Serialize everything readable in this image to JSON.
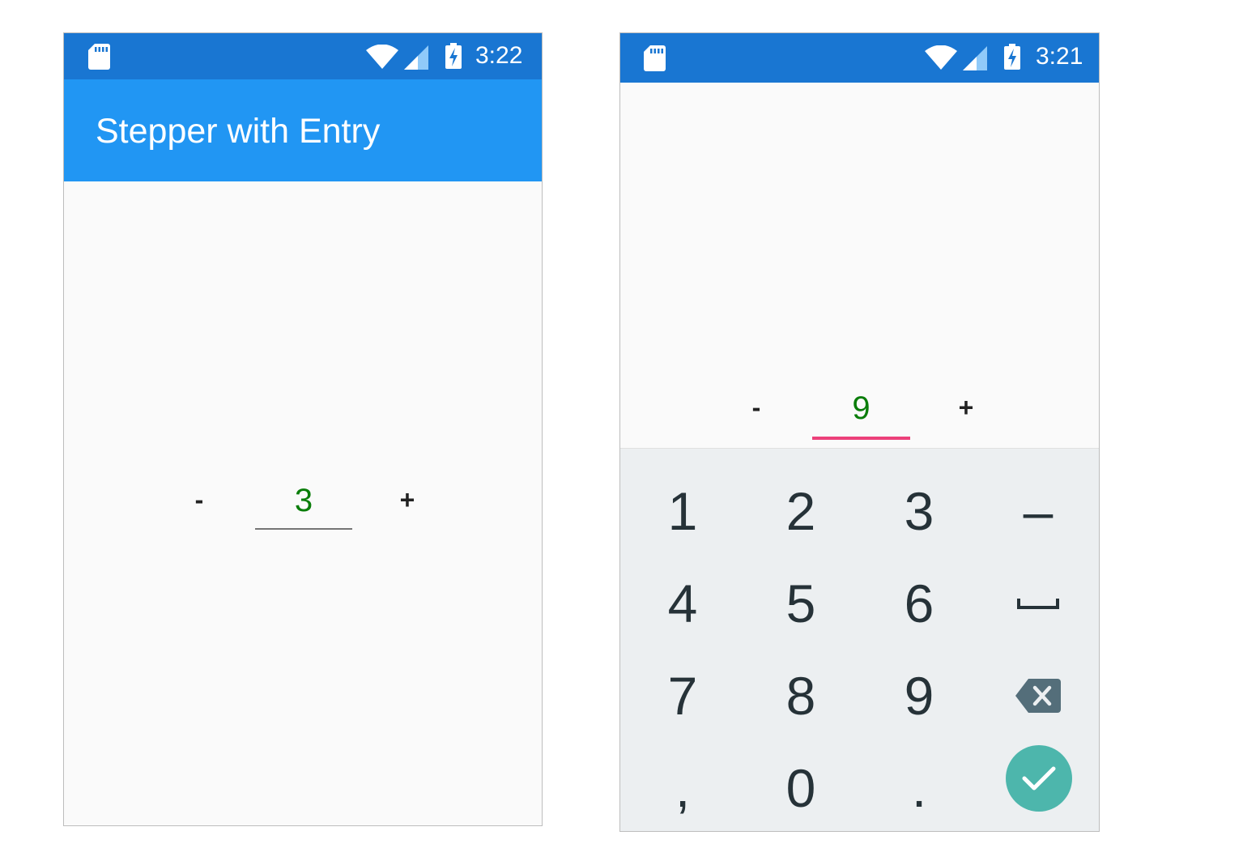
{
  "left_screen": {
    "status_bar": {
      "time": "3:22"
    },
    "app_bar": {
      "title": "Stepper with Entry"
    },
    "stepper": {
      "minus_label": "-",
      "value": "3",
      "plus_label": "+"
    }
  },
  "right_screen": {
    "status_bar": {
      "time": "3:21"
    },
    "stepper": {
      "minus_label": "-",
      "value": "9",
      "plus_label": "+"
    },
    "keyboard": {
      "keys": [
        "1",
        "2",
        "3",
        "–",
        "4",
        "5",
        "6",
        "␣",
        "7",
        "8",
        "9",
        "⌫",
        ",",
        "0",
        "."
      ],
      "done_icon": "check-icon"
    }
  },
  "colors": {
    "status_bar": "#1976d2",
    "app_bar": "#2196f3",
    "entry_text": "#0a7d0a",
    "focus_underline": "#ec407a",
    "done_button": "#4db6ac",
    "keyboard_bg": "#eceff1"
  }
}
